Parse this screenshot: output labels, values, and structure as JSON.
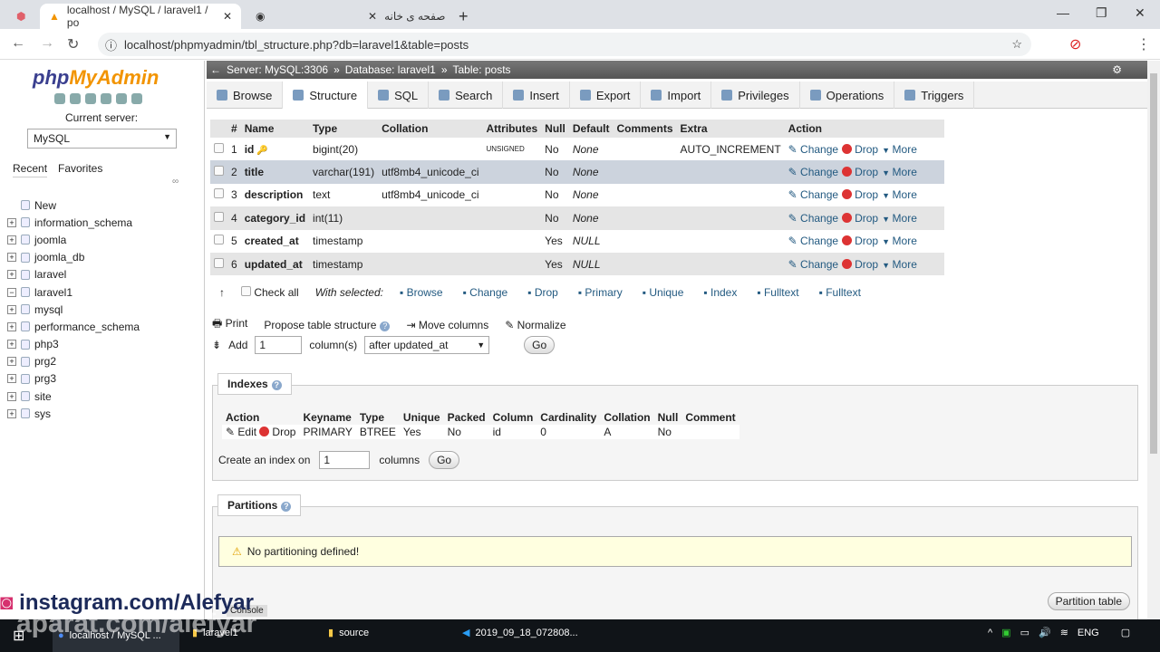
{
  "browser": {
    "tabs": [
      {
        "label": "localhost / MySQL / laravel1 / po"
      },
      {
        "label": "صفحه ی خانه"
      }
    ],
    "url": "localhost/phpmyadmin/tbl_structure.php?db=laravel1&table=posts"
  },
  "sidebar": {
    "logo": "phpMyAdmin",
    "current_server_label": "Current server:",
    "server": "MySQL",
    "recent": "Recent",
    "favorites": "Favorites",
    "databases": [
      "New",
      "information_schema",
      "joomla",
      "joomla_db",
      "laravel",
      "laravel1",
      "mysql",
      "performance_schema",
      "php3",
      "prg2",
      "prg3",
      "site",
      "sys"
    ]
  },
  "breadcrumb": {
    "server": "Server: MySQL:3306",
    "database": "Database: laravel1",
    "table": "Table: posts"
  },
  "tabs": [
    "Browse",
    "Structure",
    "SQL",
    "Search",
    "Insert",
    "Export",
    "Import",
    "Privileges",
    "Operations",
    "Triggers"
  ],
  "structure": {
    "headers": [
      "#",
      "Name",
      "Type",
      "Collation",
      "Attributes",
      "Null",
      "Default",
      "Comments",
      "Extra",
      "Action"
    ],
    "rows": [
      {
        "n": "1",
        "name": "id",
        "type": "bigint(20)",
        "collation": "",
        "attributes": "UNSIGNED",
        "null": "No",
        "default": "None",
        "extra": "AUTO_INCREMENT"
      },
      {
        "n": "2",
        "name": "title",
        "type": "varchar(191)",
        "collation": "utf8mb4_unicode_ci",
        "attributes": "",
        "null": "No",
        "default": "None",
        "extra": ""
      },
      {
        "n": "3",
        "name": "description",
        "type": "text",
        "collation": "utf8mb4_unicode_ci",
        "attributes": "",
        "null": "No",
        "default": "None",
        "extra": ""
      },
      {
        "n": "4",
        "name": "category_id",
        "type": "int(11)",
        "collation": "",
        "attributes": "",
        "null": "No",
        "default": "None",
        "extra": ""
      },
      {
        "n": "5",
        "name": "created_at",
        "type": "timestamp",
        "collation": "",
        "attributes": "",
        "null": "Yes",
        "default": "NULL",
        "extra": ""
      },
      {
        "n": "6",
        "name": "updated_at",
        "type": "timestamp",
        "collation": "",
        "attributes": "",
        "null": "Yes",
        "default": "NULL",
        "extra": ""
      }
    ],
    "actions": [
      "Change",
      "Drop",
      "More"
    ]
  },
  "bulk": {
    "check_all": "Check all",
    "with_selected": "With selected:",
    "items": [
      "Browse",
      "Change",
      "Drop",
      "Primary",
      "Unique",
      "Index",
      "Fulltext",
      "Fulltext"
    ]
  },
  "tools": {
    "print": "Print",
    "propose": "Propose table structure",
    "move": "Move columns",
    "normalize": "Normalize"
  },
  "add": {
    "label": "Add",
    "count": "1",
    "columns": "column(s)",
    "position": "after updated_at",
    "go": "Go"
  },
  "indexes": {
    "title": "Indexes",
    "headers": [
      "Action",
      "Keyname",
      "Type",
      "Unique",
      "Packed",
      "Column",
      "Cardinality",
      "Collation",
      "Null",
      "Comment"
    ],
    "row": {
      "edit": "Edit",
      "drop": "Drop",
      "keyname": "PRIMARY",
      "type": "BTREE",
      "unique": "Yes",
      "packed": "No",
      "column": "id",
      "cardinality": "0",
      "collation": "A",
      "null": "No",
      "comment": ""
    },
    "create_label": "Create an index on",
    "create_count": "1",
    "columns": "columns",
    "go": "Go"
  },
  "partitions": {
    "title": "Partitions",
    "message": "No partitioning defined!",
    "button": "Partition table"
  },
  "console": "Console",
  "watermark": {
    "instagram": "instagram.com/Alefyar",
    "aparat": "aparat.com/alefyar"
  },
  "taskbar": {
    "items": [
      "localhost / MySQL ...",
      "laravel1",
      "source",
      "2019_09_18_072808..."
    ],
    "lang": "ENG"
  }
}
